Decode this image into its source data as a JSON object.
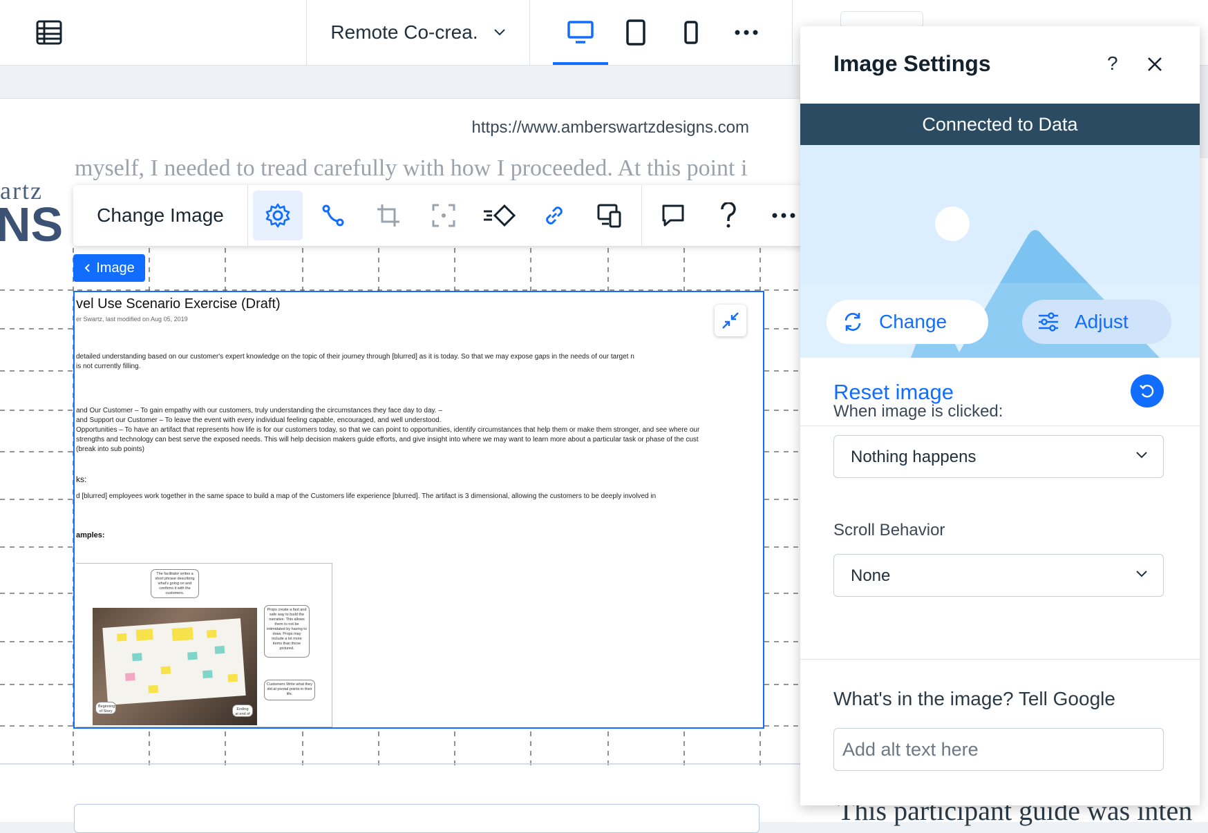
{
  "topbar": {
    "page_name": "Remote Co-crea.",
    "devices": [
      {
        "name": "desktop",
        "active": true
      },
      {
        "name": "tablet",
        "active": false
      },
      {
        "name": "mobile",
        "active": false
      }
    ]
  },
  "site": {
    "url": "https://www.amberswartzdesigns.com",
    "logo_partial_top": "artz",
    "logo_partial_bottom": "NS",
    "bg_line_top": "myself, I needed to tread carefully with how I proceeded. At this point i",
    "bg_bottom": "This participant guide was inten"
  },
  "toolbar": {
    "change_image_label": "Change Image"
  },
  "element_tag": {
    "label": "Image"
  },
  "document": {
    "title": "vel Use Scenario Exercise (Draft)",
    "meta": "er Swartz, last modified on Aug 05, 2019",
    "para1_line1": "detailed understanding based on our customer's expert knowledge on the topic of their journey through [blurred] as it is today. So that we may expose gaps in the needs of our target n",
    "para1_line2": "is not currently filling.",
    "goal1": "and Our Customer – To gain empathy with our customers, truly understanding the circumstances they face day to day. –",
    "goal2": "and Support our Customer – To leave the event with every individual feeling capable, encouraged, and well understood.",
    "goal3": "Opportunities – To have an artifact that represents how life is for our customers today, so that we can point to opportunities, identify circumstances that help them or make them stronger, and see where our",
    "goal4": "strengths and technology can best serve the exposed needs. This will help decision makers guide efforts, and give insight into where we may want to learn more about a particular task or phase of the cust",
    "goal5": "(break into sub points)",
    "tasks_heading": "ks:",
    "tasks_line": "d [blurred] employees work together in the same space to build a map of the Customers life experience [blurred]. The artifact is 3 dimensional, allowing the customers to be deeply involved in",
    "examples_heading": "amples:",
    "bubble_top": "The facilitator writes a short phrase describing what's going on and confirms it with the customers.",
    "bubble_right": "Props create a fast and safe way to build the narrative. This allows them to not be intimidated by having to draw. Props may include a lot more items than those pictured.",
    "bubble_right2": "Customers Write what they did at pivotal points in their life.",
    "bubble_bl": "Beginning of Story",
    "bubble_br": "Ending at end of story"
  },
  "panel": {
    "title": "Image Settings",
    "help": "?",
    "banner": "Connected to Data",
    "change_label": "Change",
    "adjust_label": "Adjust",
    "reset_label": "Reset image",
    "click_label": "When image is clicked:",
    "click_value": "Nothing happens",
    "scroll_label": "Scroll Behavior",
    "scroll_value": "None",
    "alt_label": "What's in the image? Tell Google",
    "alt_placeholder": "Add alt text here"
  },
  "colors": {
    "accent": "#116dff",
    "banner_bg": "#2b4b63",
    "preview_bg": "#daeeff",
    "mountain": "#7cc3f2"
  }
}
